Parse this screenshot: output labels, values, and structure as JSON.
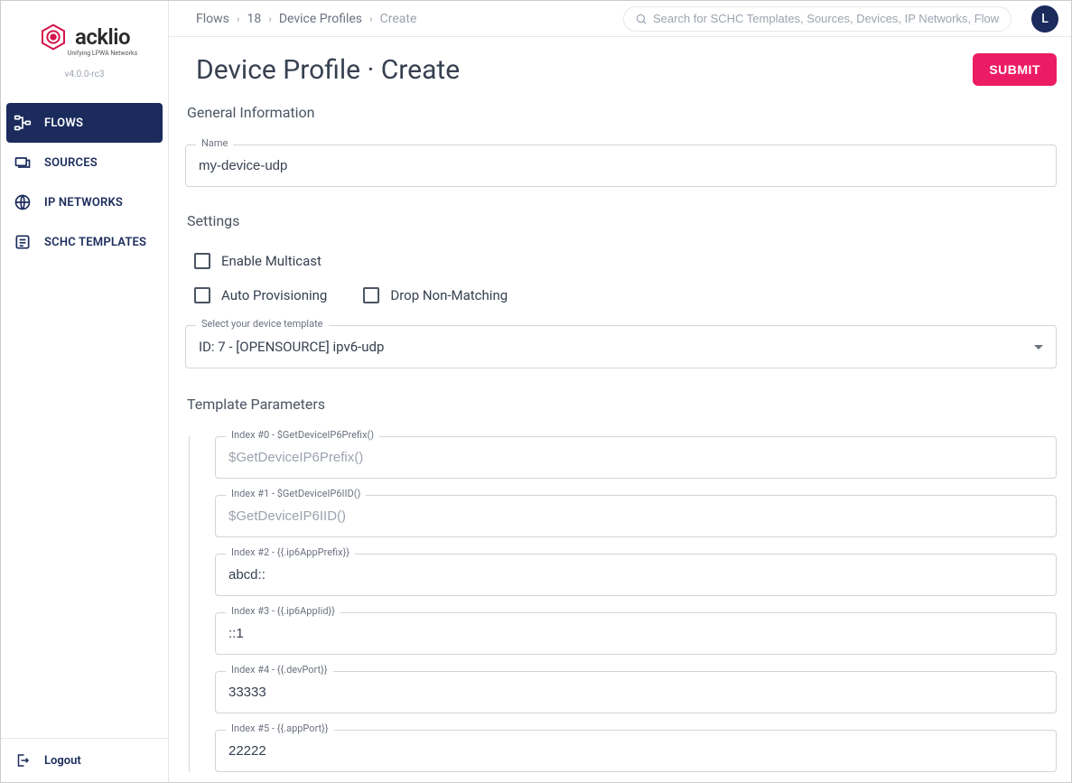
{
  "brand": {
    "name": "acklio",
    "tagline": "Unifying LPWA Networks",
    "version": "v4.0.0-rc3"
  },
  "sidebar": {
    "items": [
      {
        "label": "FLOWS"
      },
      {
        "label": "SOURCES"
      },
      {
        "label": "IP NETWORKS"
      },
      {
        "label": "SCHC TEMPLATES"
      }
    ],
    "logout": "Logout"
  },
  "topbar": {
    "breadcrumb": [
      "Flows",
      "18",
      "Device Profiles",
      "Create"
    ],
    "search_placeholder": "Search for SCHC Templates, Sources, Devices, IP Networks, Flows",
    "avatar_initial": "L"
  },
  "page": {
    "title": "Device Profile · Create",
    "submit": "SUBMIT"
  },
  "sections": {
    "general": {
      "title": "General Information",
      "name_label": "Name",
      "name_value": "my-device-udp"
    },
    "settings": {
      "title": "Settings",
      "enable_multicast": "Enable Multicast",
      "auto_provisioning": "Auto Provisioning",
      "drop_non_matching": "Drop Non-Matching",
      "template_label": "Select your device template",
      "template_value": "ID: 7 - [OPENSOURCE] ipv6-udp"
    },
    "params": {
      "title": "Template Parameters",
      "items": [
        {
          "label": "Index #0 - $GetDeviceIP6Prefix()",
          "value": "",
          "placeholder": "$GetDeviceIP6Prefix()"
        },
        {
          "label": "Index #1 - $GetDeviceIP6IID()",
          "value": "",
          "placeholder": "$GetDeviceIP6IID()"
        },
        {
          "label": "Index #2 - {{.ip6AppPrefix}}",
          "value": "abcd::",
          "placeholder": ""
        },
        {
          "label": "Index #3 - {{.ip6AppIid}}",
          "value": "::1",
          "placeholder": ""
        },
        {
          "label": "Index #4 - {{.devPort}}",
          "value": "33333",
          "placeholder": ""
        },
        {
          "label": "Index #5 - {{.appPort}}",
          "value": "22222",
          "placeholder": ""
        }
      ]
    }
  }
}
